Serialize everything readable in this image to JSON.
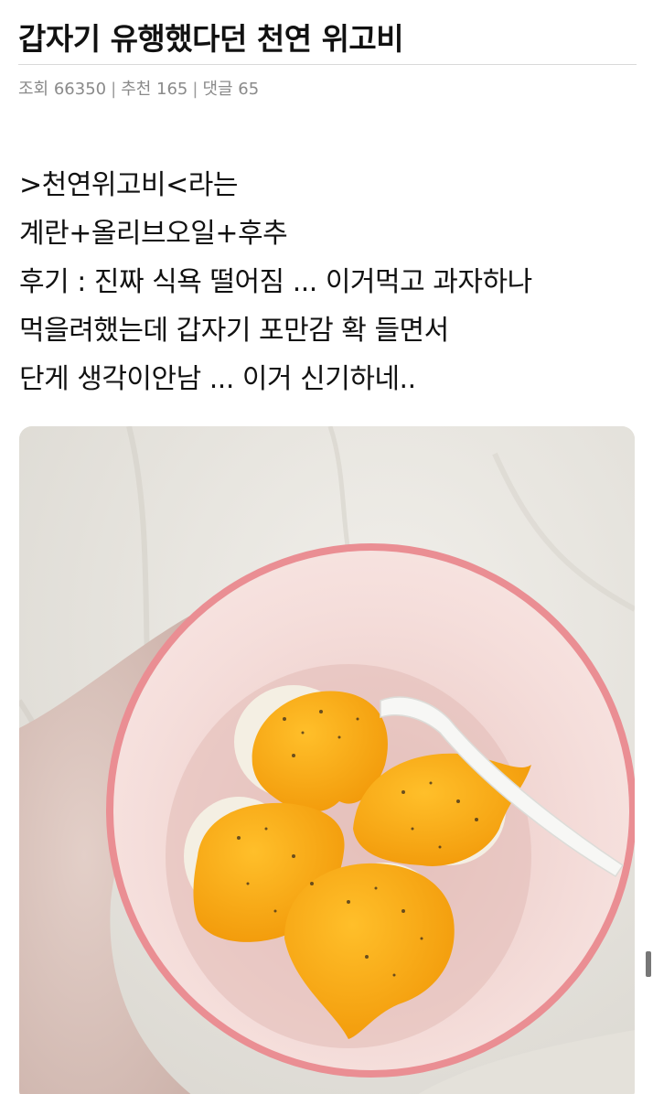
{
  "post": {
    "title": "갑자기 유행했다던 천연 위고비",
    "meta": {
      "views_label": "조회 66350",
      "likes_label": "추천 165",
      "comments_label": "댓글 65",
      "separator": "|"
    },
    "body_lines": [
      ">천연위고비<라는",
      "계란+올리브오일+후추",
      "후기 : 진짜 식욕 떨어짐 ... 이거먹고 과자하나",
      "먹을려했는데 갑자기 포만감 확 들면서",
      "단게 생각이안남 ... 이거 신기하네.."
    ]
  },
  "colors": {
    "cloth": "#ebe9e3",
    "bowl_rim": "#e98a90",
    "bowl_inner": "#f3d9d6",
    "egg_white": "#f4efe3",
    "yolk": "#f7a814",
    "fork": "#f7f7f5"
  }
}
